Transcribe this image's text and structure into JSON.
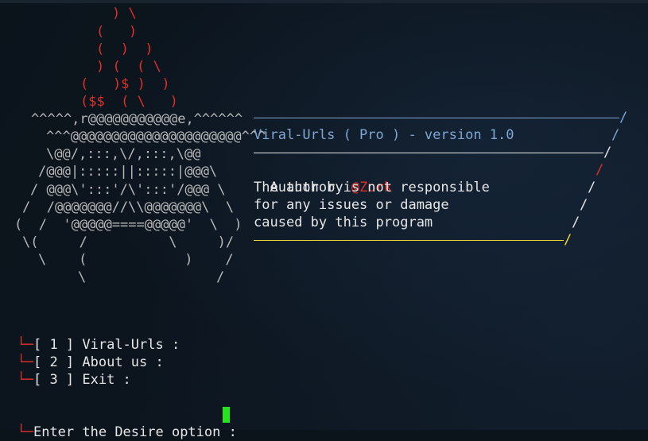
{
  "ascii_art": {
    "flame": [
      ") \\",
      "(   )",
      "(  )  )",
      ") (  ( \\",
      "(   )$ )  )",
      "($$  ( \\   )"
    ],
    "cake": [
      "^^^^^,r@@@@@@@@@@@e,^^^^^^",
      "^^^@@@@@@@@@@@@@@@@@@@@@^^^",
      "\\@@/,:::,\\/,:::,\\@@",
      "/@@@|:::::||:::::|@@@\\",
      "/ @@@\\':::'/\\':::'/@@@ \\",
      "/  /@@@@@@@//\\\\@@@@@@@\\  \\",
      "(  /  '@@@@@====@@@@@'  \\  )",
      "\\(     /          \\     )/",
      "\\    (            )    /",
      "\\                /"
    ]
  },
  "banner": {
    "title": "Viral-Urls ( Pro ) - version 1.0",
    "author_prefix": "Author by ",
    "author_name": "@Zork",
    "disclaimer": [
      "The author is not responsible",
      "for any issues or damage",
      "caused by this program"
    ],
    "slash": "/"
  },
  "menu": {
    "items": [
      "[ 1 ] Viral-Urls :",
      "[ 2 ] About us :",
      "[ 3 ] Exit :"
    ],
    "branch": "└─",
    "prompt": "Enter the Desire option : "
  },
  "colors": {
    "flame": "#e0302a",
    "art": "#b8b8b8",
    "title": "#7fa6d2",
    "text": "#e6e6e6",
    "author": "#e0302a",
    "footer_rule": "#f2dc3a",
    "cursor": "#22e51d"
  }
}
